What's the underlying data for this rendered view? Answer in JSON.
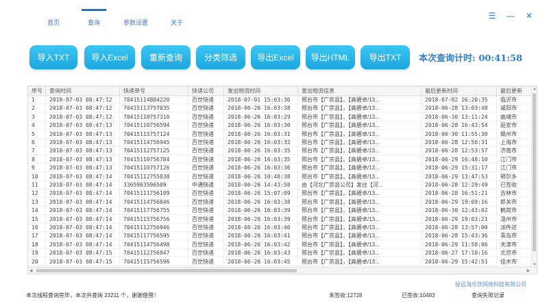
{
  "nav": {
    "tabs": [
      {
        "label": "首页"
      },
      {
        "label": "查询"
      },
      {
        "label": "参数设置"
      },
      {
        "label": "关于"
      }
    ],
    "active": "查询",
    "menu_glyph": "☰",
    "min_glyph": "—",
    "close_glyph": "✕"
  },
  "toolbar": {
    "buttons": [
      {
        "label": "导入TXT"
      },
      {
        "label": "导入Excel"
      },
      {
        "label": "重新查询"
      },
      {
        "label": "分类筛选"
      },
      {
        "label": "导出Excel"
      },
      {
        "label": "导出HTML"
      },
      {
        "label": "导出TXT"
      }
    ],
    "timer_label": "本次查询计时:",
    "timer_value": "00:41:58"
  },
  "table": {
    "columns": [
      "序号",
      "查询时间",
      "快递单号",
      "快递公司",
      "发出物流时间",
      "发出物流信息",
      "最后更新时间",
      "最后更新"
    ],
    "rows": [
      [
        "1",
        "2018-07-03 08:47:12",
        "70415114804220",
        "百世快递",
        "2018-07-01 15:03:36",
        "邢台市【广宗县】，【高碧卓/13...",
        "2018-07-02 16:20:35",
        "临沂市"
      ],
      [
        "2",
        "2018-07-03 08:47:12",
        "70415113757035",
        "百世快递",
        "2018-06-26 16:03:38",
        "邢台市【广宗县】，【高碧卓/13...",
        "2018-06-28 13:03:48",
        "咸阳市"
      ],
      [
        "3",
        "2018-07-03 08:47:12",
        "70415110757310",
        "百世快递",
        "2018-06-26 16:03:29",
        "邢台市【广宗县】，【高碧卓/13...",
        "2018-06-30 13:11:24",
        "曲靖市"
      ],
      [
        "4",
        "2018-07-03 08:47:13",
        "70415110756594",
        "百世快递",
        "2018-06-26 16:03:30",
        "邢台市【广宗县】，【高碧卓/13...",
        "2018-06-28 16:43:54",
        "延安市"
      ],
      [
        "5",
        "2018-07-03 08:47:13",
        "70415115757124",
        "百世快递",
        "2018-06-26 16:03:31",
        "邢台市【广宗县】，【高碧卓/13...",
        "2018-06-30 11:55:30",
        "赣州市"
      ],
      [
        "6",
        "2018-07-03 08:47:13",
        "70415114756945",
        "百世快递",
        "2018-06-26 16:03:32",
        "邢台市【广宗县】，【高碧卓/13...",
        "2018-06-28 12:56:31",
        "上海市"
      ],
      [
        "7",
        "2018-07-03 08:47:13",
        "70415112757125",
        "百世快递",
        "2018-06-26 16:03:35",
        "邢台市【广宗县】，【高碧卓/13...",
        "2018-06-28 12:53:57",
        "济南市"
      ],
      [
        "8",
        "2018-07-03 08:47:13",
        "70415110756784",
        "百世快递",
        "2018-06-26 16:03:35",
        "邢台市【广宗县】，【高碧卓/13...",
        "2018-06-29 16:48:10",
        "江门市"
      ],
      [
        "9",
        "2018-07-03 08:47:13",
        "70415110757126",
        "百世快递",
        "2018-06-26 16:03:36",
        "邢台市【广宗县】，【高碧卓/13...",
        "2018-06-29 15:31:17",
        "江门市"
      ],
      [
        "10",
        "2018-07-03 08:47:14",
        "70415112755838",
        "百世快递",
        "2018-06-26 10:48:38",
        "邢台市【广宗县】，【高碧卓/13...",
        "2018-06-29 13:47:53",
        "鄂尔多"
      ],
      [
        "11",
        "2018-07-03 08:47:14",
        "3365963596509",
        "中通快递",
        "2018-06-26 14:43:58",
        "由【河北广宗县公司】发往【河...",
        "2018-06-28 12:29:49",
        "已签收"
      ],
      [
        "12",
        "2018-07-03 08:47:14",
        "70415111756109",
        "百世快递",
        "2018-06-26 15:07:09",
        "邢台市【广宗县】，【高碧卓/13...",
        "2018-06-28 16:51:21",
        "吉林市"
      ],
      [
        "13",
        "2018-07-03 08:47:14",
        "70415114756846",
        "百世快递",
        "2018-06-26 16:03:38",
        "邢台市【广宗县】，【高碧卓/13...",
        "2018-06-29 19:09:16",
        "郎关市"
      ],
      [
        "14",
        "2018-07-03 08:47:14",
        "70415117756755",
        "百世快递",
        "2018-06-26 16:03:39",
        "邢台市【广宗县】，【高碧卓/13...",
        "2018-06-30 12:43:02",
        "鹤岗市"
      ],
      [
        "15",
        "2018-07-03 08:47:14",
        "70415115756756",
        "百世快递",
        "2018-06-26 16:03:39",
        "邢台市【广宗县】，【高碧卓/13...",
        "2018-06-29 19:03:21",
        "温州市"
      ],
      [
        "16",
        "2018-07-03 08:47:14",
        "70415112756946",
        "百世快递",
        "2018-06-26 16:03:40",
        "邢台市【广宗县】，【高碧卓/13...",
        "2018-06-28 13:57:00",
        "派件送"
      ],
      [
        "17",
        "2018-07-03 08:47:14",
        "70415117756595",
        "百世快递",
        "2018-06-26 16:03:41",
        "邢台市【广宗县】，【高碧卓/13...",
        "2018-06-28 15:43:36",
        "青岛市"
      ],
      [
        "18",
        "2018-07-03 08:47:14",
        "70415114756498",
        "百世快递",
        "2018-06-26 16:03:42",
        "邢台市【广宗县】，【高碧卓/13...",
        "2018-06-29 11:58:06",
        "天津市"
      ],
      [
        "19",
        "2018-07-03 08:47:15",
        "70415112756847",
        "百世快递",
        "2018-06-26 16:03:43",
        "邢台市【广宗县】，【高碧卓/13...",
        "2018-06-27 17:10:16",
        "北京市"
      ],
      [
        "20",
        "2018-07-03 08:47:15",
        "70415115756596",
        "百世快递",
        "2018-06-26 16:03:45",
        "邢台市【广宗县】，【高碧卓/13...",
        "2018-06-29 15:42:51",
        "佳木市"
      ]
    ]
  },
  "company": "投远海乐优网络科技有限公司",
  "status": {
    "message": "本次线程查询完毕，本次共查询 23211 个，谢谢使用！",
    "unsigned": "未签收:12728",
    "signed": "已签收:10483",
    "failed": "查询失败记录"
  },
  "colors": {
    "accent": "#1a73c9",
    "button": "#29b3e8",
    "timer": "#2f7fc8"
  }
}
